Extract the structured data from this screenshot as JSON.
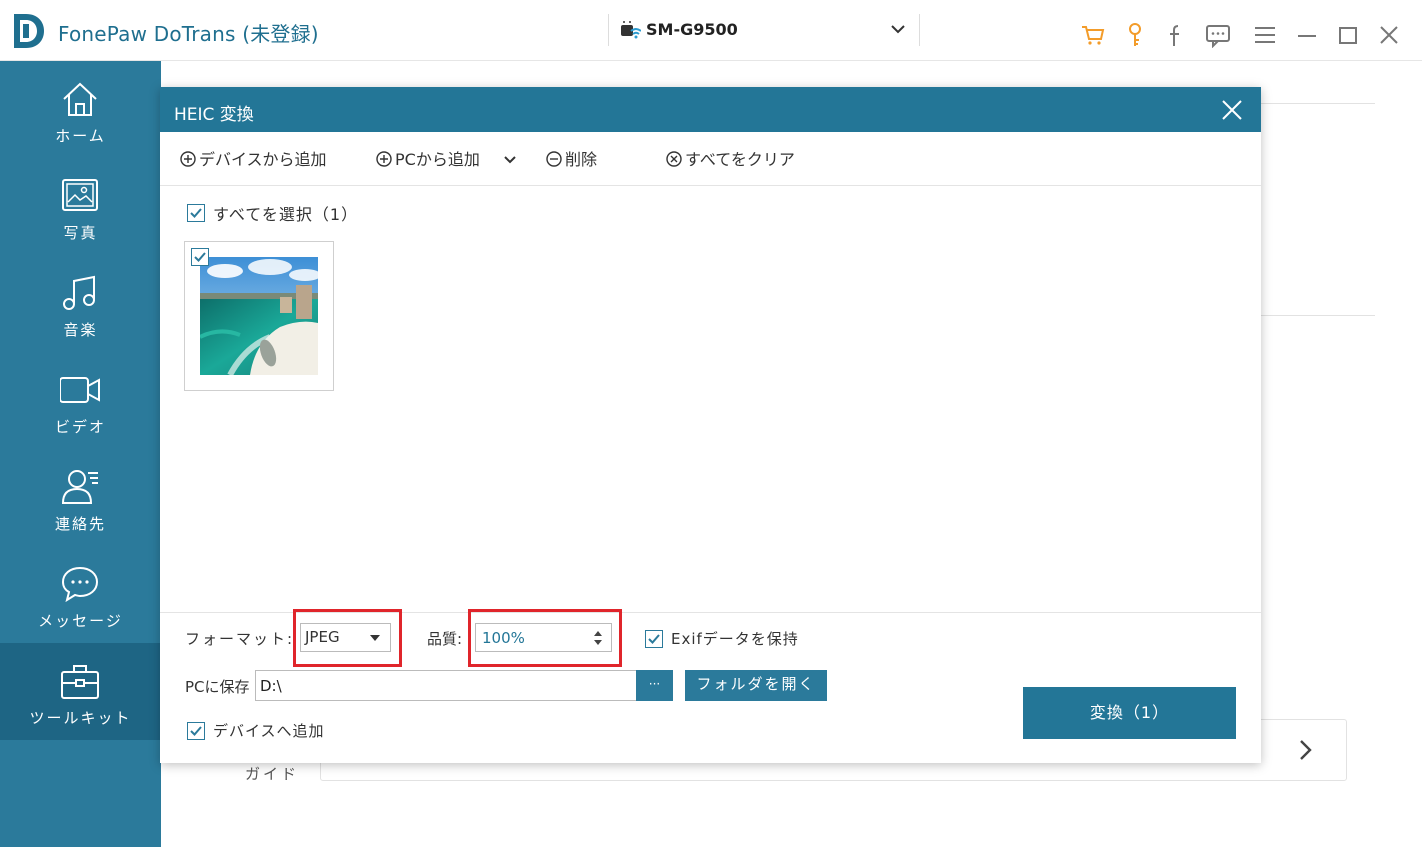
{
  "app": {
    "title": "FonePaw DoTrans",
    "registration": "(未登録)"
  },
  "device": {
    "name": "SM-G9500"
  },
  "titlebar_icons": [
    "cart-icon",
    "key-icon",
    "facebook-icon",
    "feedback-icon",
    "menu-icon",
    "minimize-icon",
    "maximize-icon",
    "close-icon"
  ],
  "sidebar": {
    "items": [
      {
        "label": "ホーム",
        "icon": "home-icon"
      },
      {
        "label": "写真",
        "icon": "photo-icon"
      },
      {
        "label": "音楽",
        "icon": "music-icon"
      },
      {
        "label": "ビデオ",
        "icon": "video-icon"
      },
      {
        "label": "連絡先",
        "icon": "contacts-icon"
      },
      {
        "label": "メッセージ",
        "icon": "message-icon"
      },
      {
        "label": "ツールキット",
        "icon": "toolkit-icon",
        "active": true
      }
    ]
  },
  "background": {
    "guide_label": "ガイド"
  },
  "dialog": {
    "title": "HEIC 変換",
    "toolbar": {
      "add_from_device": "デバイスから追加",
      "add_from_pc": "PCから追加",
      "delete": "削除",
      "clear_all": "すべてをクリア"
    },
    "select_all": {
      "label": "すべてを選択（1）",
      "checked": true
    },
    "thumbnails": [
      {
        "checked": true,
        "description": "beach-photo"
      }
    ],
    "format": {
      "label": "フォーマット:",
      "value": "JPEG"
    },
    "quality": {
      "label": "品質:",
      "value": "100%"
    },
    "keep_exif": {
      "label": "Exifデータを保持",
      "checked": true
    },
    "save_to_pc": {
      "label": "PCに保存",
      "value": "D:\\",
      "browse_label": "···"
    },
    "open_folder_label": "フォルダを開く",
    "add_to_device": {
      "label": "デバイスへ追加",
      "checked": true
    },
    "convert_label": "変換（1）"
  },
  "colors": {
    "primary": "#2b7a9b",
    "header": "#237697",
    "sidebar_active": "#1e6584",
    "highlight_red": "#e0252b",
    "accent_orange": "#f39c2a"
  }
}
